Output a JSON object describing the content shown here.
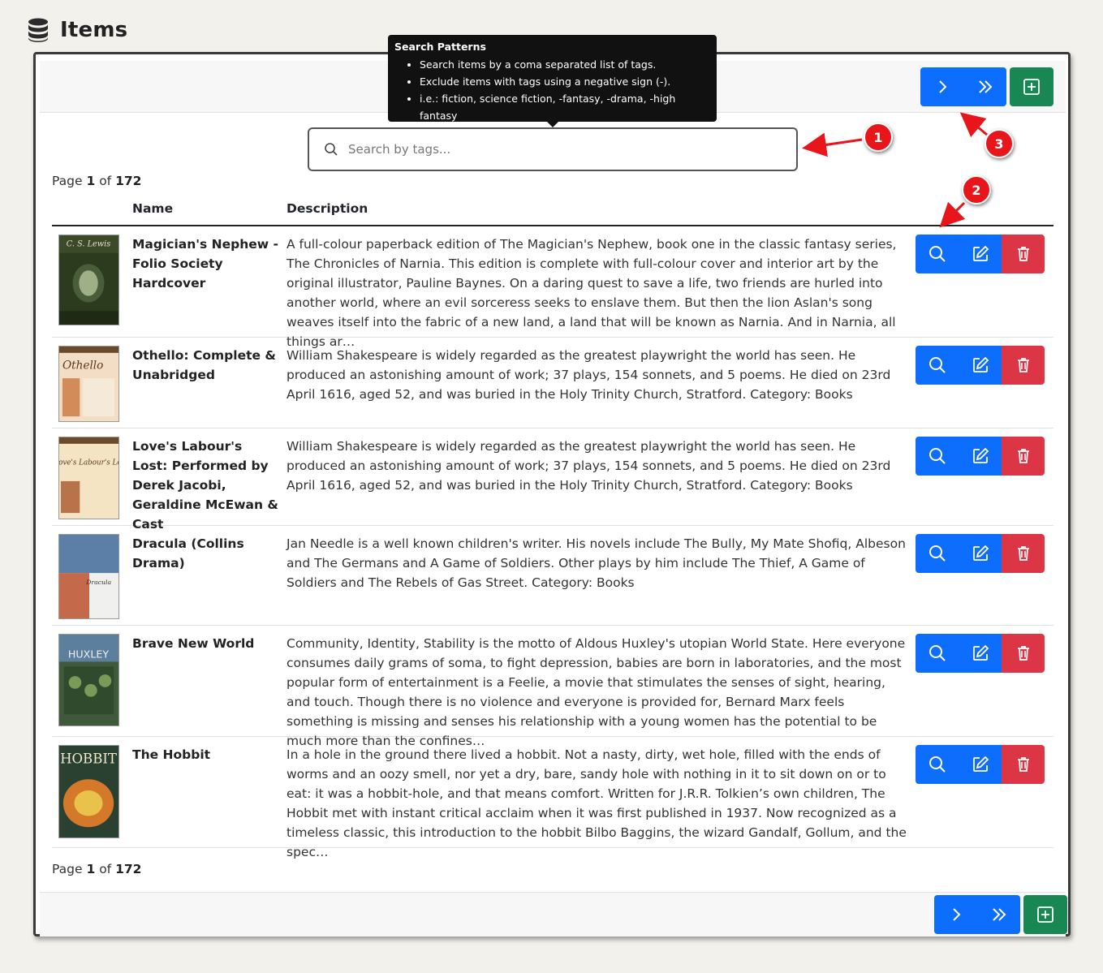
{
  "header": {
    "title": "Items",
    "icon": "database-icon"
  },
  "toolbar": {
    "next_icon": "chevron-right-icon",
    "last_icon": "double-chevron-right-icon",
    "add_icon": "plus-square-icon"
  },
  "tooltip": {
    "title": "Search Patterns",
    "lines": [
      "Search items by a coma separated list of tags.",
      "Exclude items with tags using a negative sign (-).",
      "i.e.: fiction, science fiction, -fantasy, -drama, -high fantasy"
    ]
  },
  "search": {
    "placeholder": "Search by tags...",
    "value": ""
  },
  "pagination": {
    "prefix": "Page",
    "current": "1",
    "of": "of",
    "total": "172"
  },
  "table": {
    "columns": {
      "name": "Name",
      "description": "Description"
    },
    "rows": [
      {
        "name": "Magician's Nephew - Folio Society Hardcover",
        "description": "A full-colour paperback edition of The Magician's Nephew, book one in the classic fantasy series, The Chronicles of Narnia. This edition is complete with full-colour cover and interior art by the original illustrator, Pauline Baynes. On a daring quest to save a life, two friends are hurled into another world, where an evil sorceress seeks to enslave them. But then the lion Aslan's song weaves itself into the fabric of a new land, a land that will be known as Narnia. And in Narnia, all things ar…",
        "cover_text": "C. S. Lewis"
      },
      {
        "name": "Othello: Complete & Unabridged",
        "description": "William Shakespeare is widely regarded as the greatest playwright the world has seen. He produced an astonishing amount of work; 37 plays, 154 sonnets, and 5 poems. He died on 23rd April 1616, aged 52, and was buried in the Holy Trinity Church, Stratford. Category: Books",
        "cover_text": "Othello"
      },
      {
        "name": "Love's Labour's Lost: Performed by Derek Jacobi, Geraldine McEwan & Cast",
        "description": "William Shakespeare is widely regarded as the greatest playwright the world has seen. He produced an astonishing amount of work; 37 plays, 154 sonnets, and 5 poems. He died on 23rd April 1616, aged 52, and was buried in the Holy Trinity Church, Stratford. Category: Books",
        "cover_text": "Love's Labour's Lost"
      },
      {
        "name": "Dracula (Collins Drama)",
        "description": "Jan Needle is a well known children's writer. His novels include The Bully, My Mate Shofiq, Albeson and The Germans and A Game of Soldiers. Other plays by him include The Thief, A Game of Soldiers and The Rebels of Gas Street. Category: Books",
        "cover_text": "Dracula"
      },
      {
        "name": "Brave New World",
        "description": "Community, Identity, Stability is the motto of Aldous Huxley's utopian World State. Here everyone consumes daily grams of soma, to fight depression, babies are born in laboratories, and the most popular form of entertainment is a Feelie, a movie that stimulates the senses of sight, hearing, and touch. Though there is no violence and everyone is provided for, Bernard Marx feels something is missing and senses his relationship with a young women has the potential to be much more than the confines…",
        "cover_text": "HUXLEY"
      },
      {
        "name": "The Hobbit",
        "description": "In a hole in the ground there lived a hobbit. Not a nasty, dirty, wet hole, filled with the ends of worms and an oozy smell, nor yet a dry, bare, sandy hole with nothing in it to sit down on or to eat: it was a hobbit-hole, and that means comfort. Written for J.R.R. Tolkien’s own children, The Hobbit met with instant critical acclaim when it was first published in 1937. Now recognized as a timeless classic, this introduction to the hobbit Bilbo Baggins, the wizard Gandalf, Gollum, and the spec…",
        "cover_text": "HOBBIT"
      }
    ],
    "row_actions": [
      "search-icon",
      "edit-icon",
      "trash-icon"
    ]
  },
  "callouts": [
    "1",
    "2",
    "3"
  ],
  "colors": {
    "primary": "#0d6efd",
    "success": "#198754",
    "danger": "#dc3545",
    "callout": "#e8161b"
  }
}
